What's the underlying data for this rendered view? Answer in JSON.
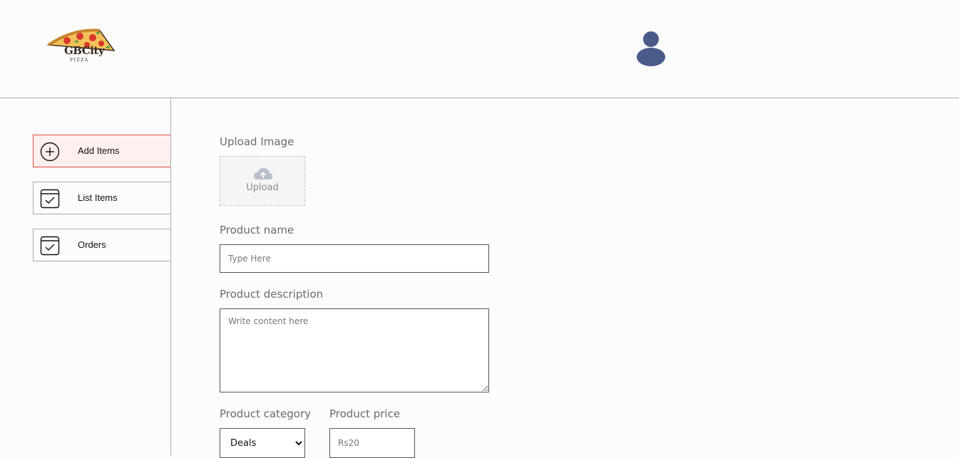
{
  "brand": {
    "logo_text": "GBCity",
    "logo_subtext": "PIZZA"
  },
  "header": {
    "profile_icon": "user-icon"
  },
  "sidebar": {
    "items": [
      {
        "label": "Add Items",
        "icon": "add-circle-icon",
        "active": true
      },
      {
        "label": "List Items",
        "icon": "checklist-icon",
        "active": false
      },
      {
        "label": "Orders",
        "icon": "checklist-icon",
        "active": false
      }
    ]
  },
  "form": {
    "upload_label": "Upload Image",
    "upload_button": "Upload",
    "name_label": "Product name",
    "name_placeholder": "Type Here",
    "description_label": "Product description",
    "description_placeholder": "Write content here",
    "category_label": "Product category",
    "category_selected": "Deals",
    "price_label": "Product price",
    "price_placeholder": "Rs20"
  },
  "colors": {
    "accent": "#e0483a",
    "active_bg": "#fff0ef",
    "profile": "#4a5a8a"
  }
}
